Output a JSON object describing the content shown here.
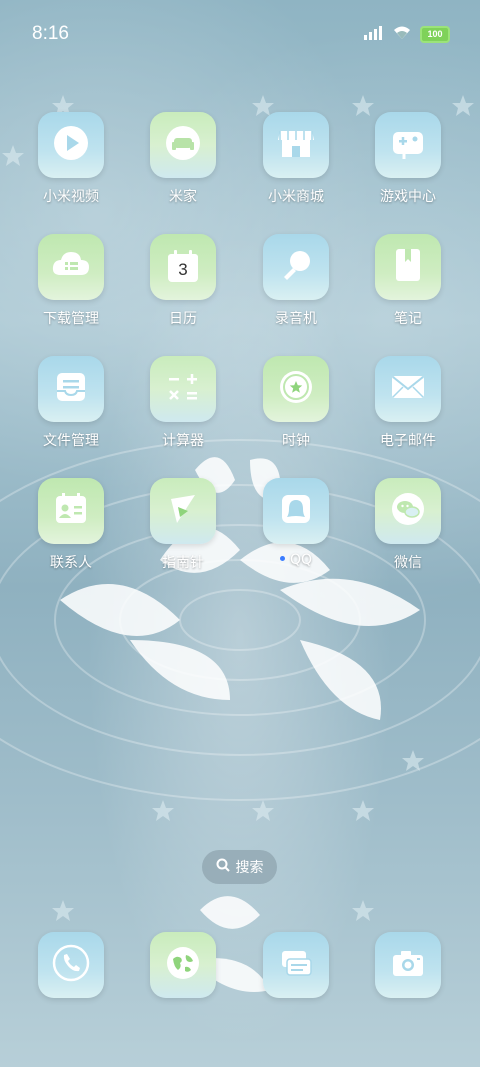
{
  "status_bar": {
    "time": "8:16",
    "battery": "100",
    "icons": [
      "signal-icon",
      "wifi-icon",
      "battery-icon"
    ]
  },
  "apps": [
    {
      "label": "小米视频",
      "icon": "play-icon"
    },
    {
      "label": "米家",
      "icon": "sofa-icon"
    },
    {
      "label": "小米商城",
      "icon": "store-icon"
    },
    {
      "label": "游戏中心",
      "icon": "gamepad-icon"
    },
    {
      "label": "下载管理",
      "icon": "cloud-download-icon"
    },
    {
      "label": "日历",
      "icon": "calendar-icon",
      "day": "3"
    },
    {
      "label": "录音机",
      "icon": "microphone-icon"
    },
    {
      "label": "笔记",
      "icon": "notebook-icon"
    },
    {
      "label": "文件管理",
      "icon": "folder-icon"
    },
    {
      "label": "计算器",
      "icon": "calculator-icon"
    },
    {
      "label": "时钟",
      "icon": "clock-icon"
    },
    {
      "label": "电子邮件",
      "icon": "envelope-icon"
    },
    {
      "label": "联系人",
      "icon": "contact-card-icon"
    },
    {
      "label": "指南针",
      "icon": "compass-icon"
    },
    {
      "label": "QQ",
      "icon": "qq-icon"
    },
    {
      "label": "微信",
      "icon": "wechat-icon"
    }
  ],
  "search": {
    "label": "搜索",
    "icon": "search-icon"
  },
  "dock": [
    {
      "icon": "phone-icon"
    },
    {
      "icon": "browser-icon"
    },
    {
      "icon": "messages-icon"
    },
    {
      "icon": "camera-icon"
    }
  ],
  "colors": {
    "tile_blue": "#a9d8ea",
    "tile_green": "#bfe8b0",
    "icon_white": "#ffffff",
    "notification_dot": "#3a7cff"
  }
}
